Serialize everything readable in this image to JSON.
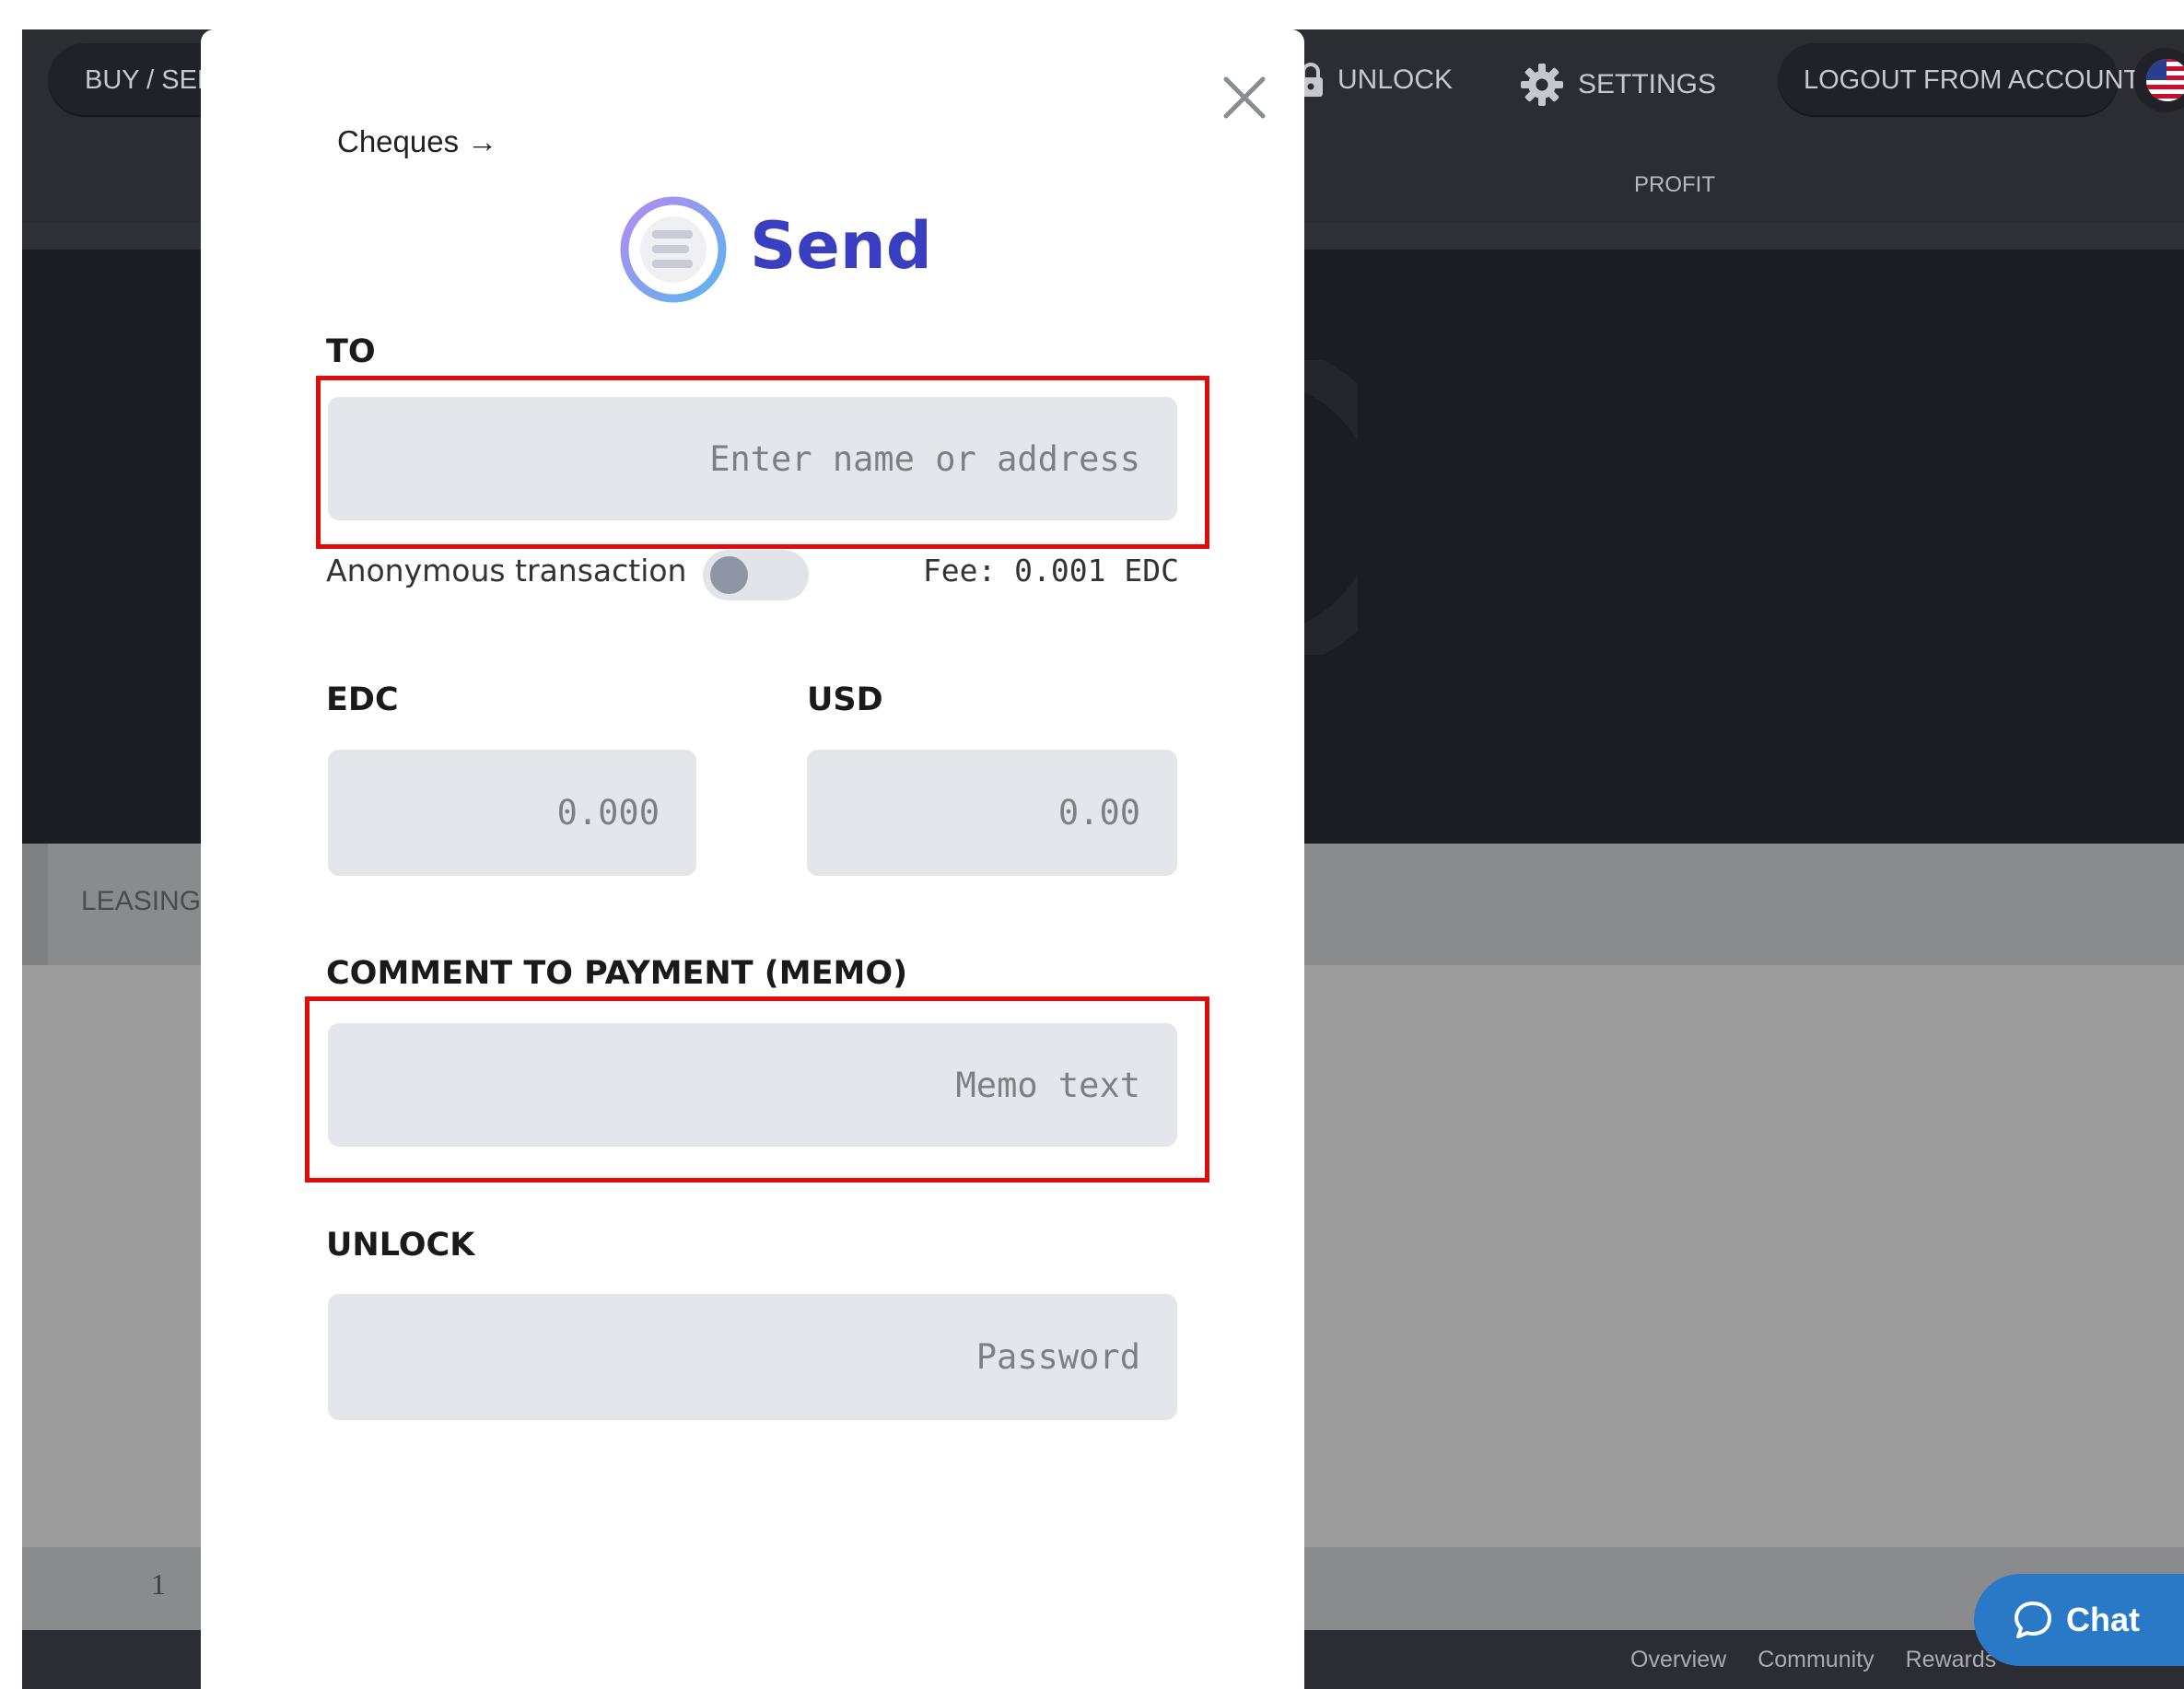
{
  "topnav": {
    "buy_sell": "BUY / SELL",
    "unlock": "UNLOCK",
    "settings": "SETTINGS",
    "logout": "LOGOUT FROM ACCOUNT",
    "profit": "PROFIT"
  },
  "background": {
    "leasing_tab": "LEASING",
    "page_number": "1"
  },
  "footer": {
    "links": [
      "Overview",
      "Community",
      "Rewards"
    ]
  },
  "chat": {
    "label": "Chat"
  },
  "modal": {
    "cheques_link": "Cheques →",
    "title": "Send",
    "to_label": "TO",
    "to_placeholder": "Enter name or address",
    "anonymous_label": "Anonymous transaction",
    "anonymous_enabled": false,
    "fee": "Fee: 0.001 EDC",
    "edc_label": "EDC",
    "edc_placeholder": "0.000",
    "usd_label": "USD",
    "usd_placeholder": "0.00",
    "memo_label": "COMMENT TO PAYMENT (MEMO)",
    "memo_placeholder": "Memo text",
    "unlock_label": "UNLOCK",
    "password_placeholder": "Password"
  },
  "colors": {
    "brand": "#3a3fc2",
    "highlight": "#e10b0b",
    "chat": "#2a79c6"
  }
}
